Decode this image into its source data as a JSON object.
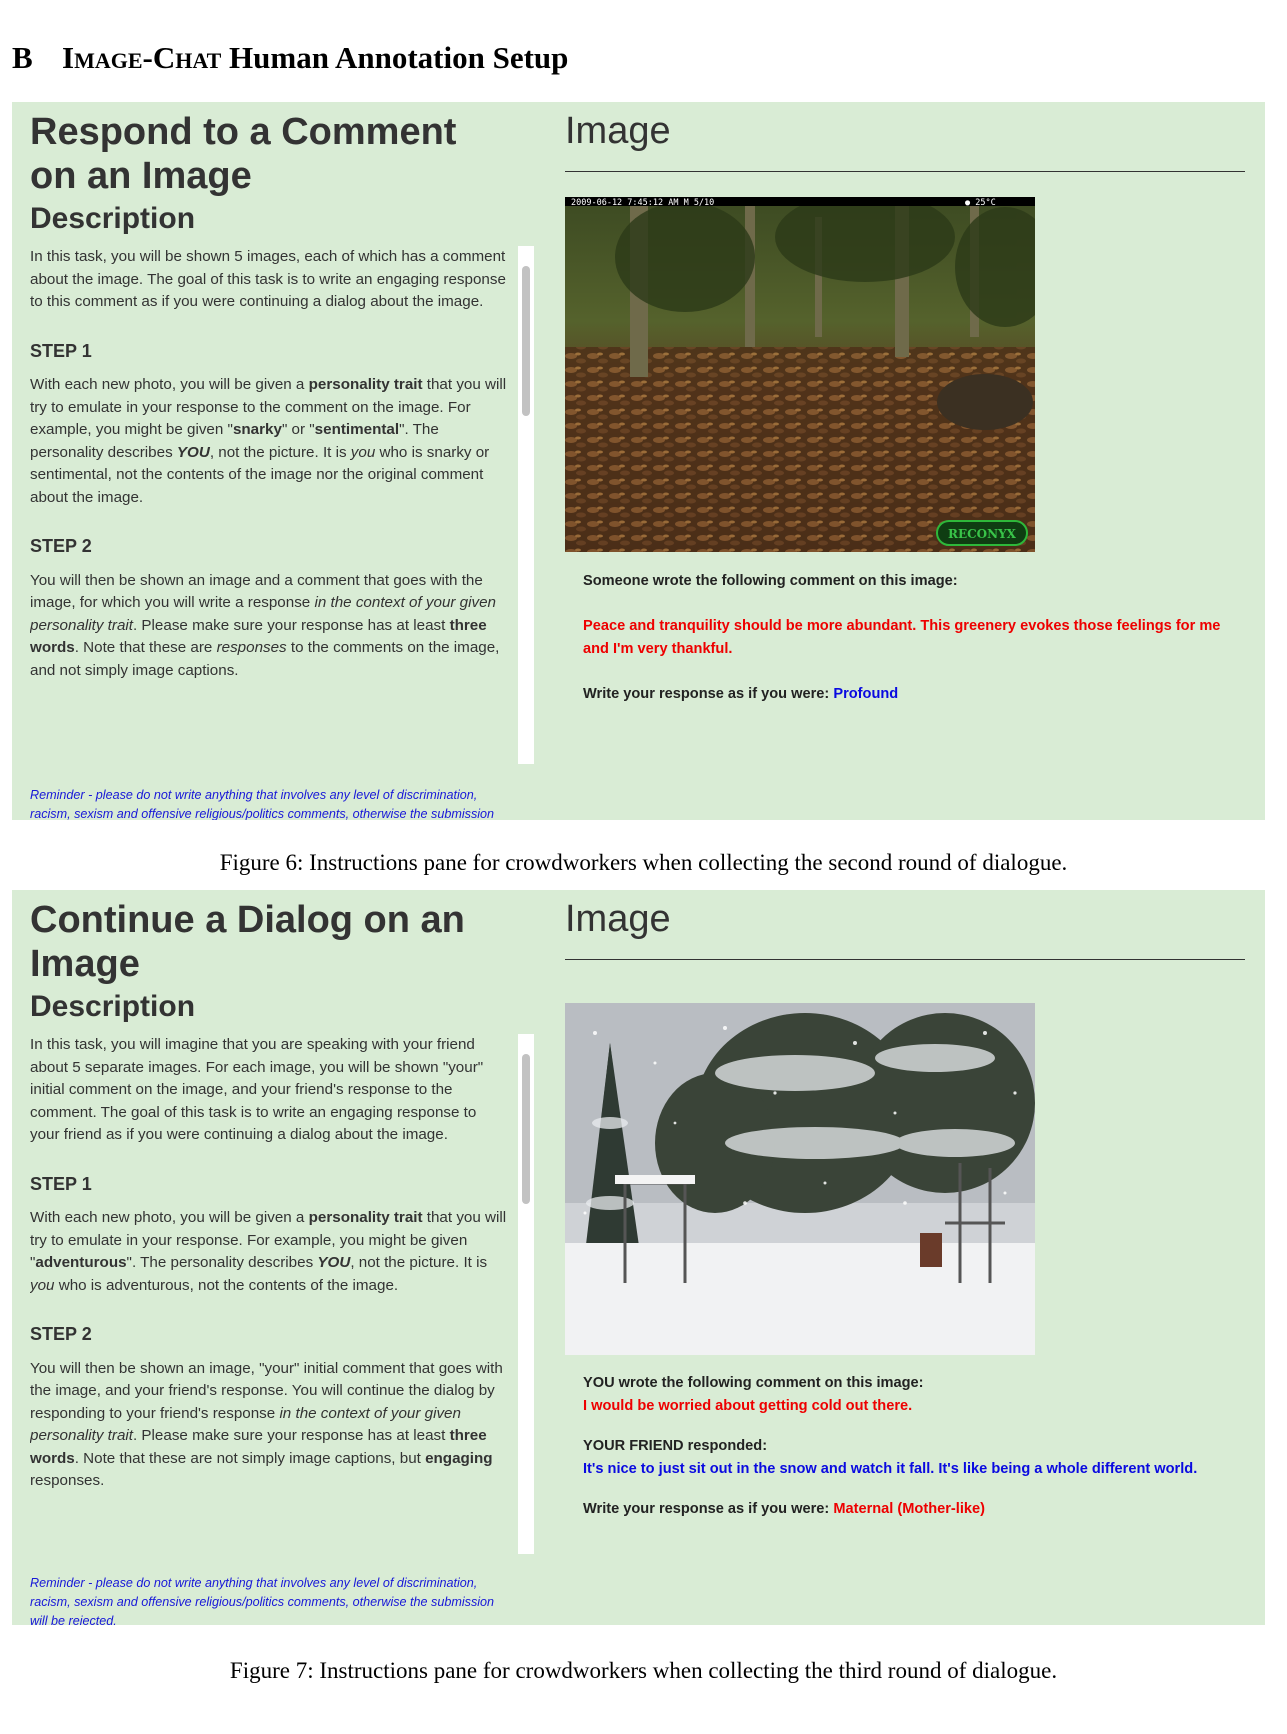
{
  "section": {
    "number": "B",
    "title_sc": "Image-Chat",
    "title_rest": " Human Annotation Setup"
  },
  "figure6": {
    "heading": "Respond to a Comment on an Image",
    "description_heading": "Description",
    "intro": "In this task, you will be shown 5 images, each of which has a comment about the image. The goal of this task is to write an engaging response to this comment as if you were continuing a dialog about the image.",
    "step1_heading": "STEP 1",
    "step1": {
      "a": "With each new photo, you will be given a ",
      "b": "personality trait",
      "c": " that you will try to emulate in your response to the comment on the image. For example, you might be given \"",
      "d": "snarky",
      "e": "\" or \"",
      "f": "sentimental",
      "g": "\". The personality describes ",
      "h": "YOU",
      "i": ", not the picture. It is ",
      "j": "you",
      "k": " who is snarky or sentimental, not the contents of the image nor the original comment about the image."
    },
    "step2_heading": "STEP 2",
    "step2": {
      "a": "You will then be shown an image and a comment that goes with the image, for which you will write a response ",
      "b": "in the context of your given personality trait",
      "c": ". Please make sure your response has at least ",
      "d": "three words",
      "e": ". Note that these are ",
      "f": "responses",
      "g": " to the comments on the image, and not simply image captions."
    },
    "reminder": "Reminder - please do not write anything that involves any level of discrimination, racism, sexism and offensive religious/politics comments, otherwise the submission will be rejected.",
    "image_heading": "Image",
    "camera_stamp_left": "2009-06-12  7:45:12 AM     M 5/10",
    "camera_stamp_right": "●   25°C",
    "camera_logo": "RECONYX",
    "comment_label": "Someone wrote the following comment on this image:",
    "comment": "Peace and tranquility should be more abundant. This greenery evokes those feelings for me and I'm very thankful.",
    "respond_label": "Write your response as if you were: ",
    "trait": "Profound",
    "caption": "Figure 6: Instructions pane for crowdworkers when collecting the second round of dialogue."
  },
  "figure7": {
    "heading": "Continue a Dialog on an Image",
    "description_heading": "Description",
    "intro": "In this task, you will imagine that you are speaking with your friend about 5 separate images. For each image, you will be shown \"your\" initial comment on the image, and your friend's response to the comment. The goal of this task is to write an engaging response to your friend as if you were continuing a dialog about the image.",
    "step1_heading": "STEP 1",
    "step1": {
      "a": "With each new photo, you will be given a ",
      "b": "personality trait",
      "c": " that you will try to emulate in your response. For example, you might be given \"",
      "d": "adventurous",
      "e": "\". The personality describes ",
      "f": "YOU",
      "g": ", not the picture. It is ",
      "h": "you",
      "i": " who is adventurous, not the contents of the image."
    },
    "step2_heading": "STEP 2",
    "step2": {
      "a": "You will then be shown an image, \"your\" initial comment that goes with the image, and your friend's response. You will continue the dialog by responding to your friend's response ",
      "b": "in the context of your given personality trait",
      "c": ". Please make sure your response has at least ",
      "d": "three words",
      "e": ". Note that these are not simply image captions, but ",
      "f": "engaging",
      "g": " responses."
    },
    "reminder": "Reminder - please do not write anything that involves any level of discrimination, racism, sexism and offensive religious/politics comments, otherwise the submission will be rejected.",
    "image_heading": "Image",
    "you_label_bold": "YOU",
    "you_label_rest": " wrote the following comment on this image:",
    "you_comment": "I would be worried about getting cold out there.",
    "friend_label": "YOUR FRIEND responded:",
    "friend_comment": "It's nice to just sit out in the snow and watch it fall. It's like being a whole different world.",
    "respond_label": "Write your response as if you were: ",
    "trait": "Maternal (Mother-like)",
    "caption": "Figure 7: Instructions pane for crowdworkers when collecting the third round of dialogue."
  },
  "colors": {
    "panel_bg": "#d9ecd5",
    "comment_red": "#ee0000",
    "trait_blue": "#0a0ae0",
    "reminder_blue": "#1818d8"
  }
}
